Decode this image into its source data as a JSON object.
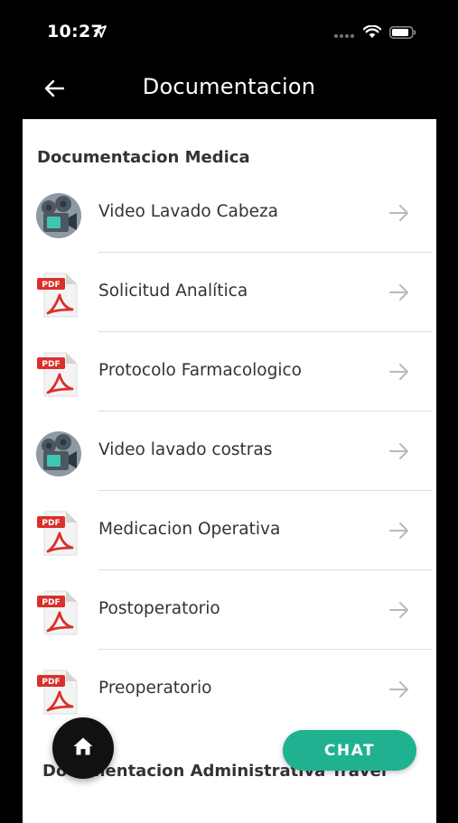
{
  "status_bar": {
    "time": "10:27",
    "signal_dots": "....",
    "icons": [
      "location-arrow-icon",
      "wifi-icon",
      "battery-icon"
    ]
  },
  "header": {
    "title": "Documentacion",
    "back_icon": "arrow-left-icon"
  },
  "sections": [
    {
      "title": "Documentacion Medica",
      "items": [
        {
          "label": "Video Lavado Cabeza",
          "icon": "video-camera-icon"
        },
        {
          "label": "Solicitud Analítica",
          "icon": "pdf-icon"
        },
        {
          "label": "Protocolo Farmacologico",
          "icon": "pdf-icon"
        },
        {
          "label": "Video lavado costras",
          "icon": "video-camera-icon"
        },
        {
          "label": "Medicacion Operativa",
          "icon": "pdf-icon"
        },
        {
          "label": "Postoperatorio",
          "icon": "pdf-icon"
        },
        {
          "label": "Preoperatorio",
          "icon": "pdf-icon"
        }
      ]
    },
    {
      "title": "Documentacion Administrativa Travel"
    }
  ],
  "fab": {
    "icon": "home-icon"
  },
  "chat_button": {
    "label": "CHAT"
  },
  "colors": {
    "background": "#000000",
    "panel": "#ffffff",
    "accent": "#20b290",
    "pdf_red": "#d9302c"
  }
}
